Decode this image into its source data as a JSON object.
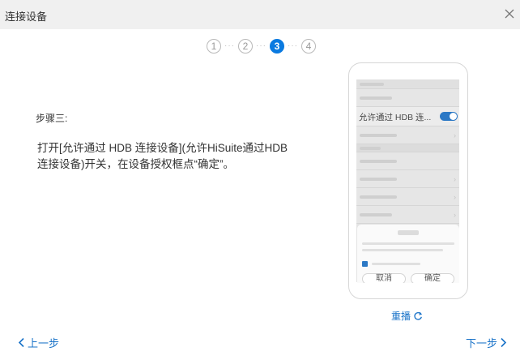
{
  "window": {
    "title": "连接设备"
  },
  "stepper": {
    "steps": [
      "1",
      "2",
      "3",
      "4"
    ],
    "active_step": 3
  },
  "content": {
    "step_label": "步骤三:",
    "instruction": "打开[允许通过 HDB 连接设备](允许HiSuite通过HDB连接设备)开关，在设备授权框点“确定”。"
  },
  "phone": {
    "setting_label": "允许通过 HDB 连...",
    "toggle_on": true,
    "dialog_cancel": "取消",
    "dialog_confirm": "确定"
  },
  "replay": {
    "label": "重播"
  },
  "nav": {
    "prev_label": "上一步",
    "next_label": "下一步"
  },
  "colors": {
    "accent": "#0a7ae0",
    "link": "#1a73c8",
    "titlebar": "#f0f0f0"
  }
}
